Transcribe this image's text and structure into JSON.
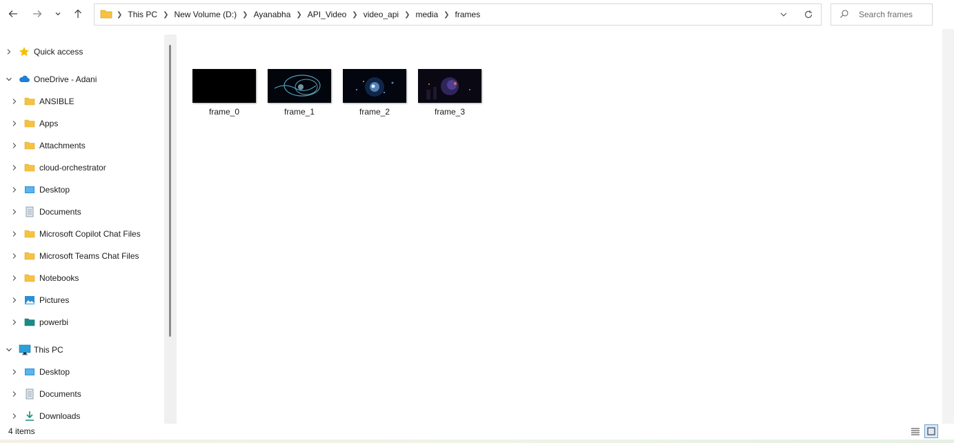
{
  "nav": {
    "back_icon": "arrow-left-icon",
    "forward_icon": "arrow-right-icon",
    "recent_icon": "chevron-down-icon",
    "up_icon": "arrow-up-icon"
  },
  "address": {
    "crumbs": [
      "This PC",
      "New Volume (D:)",
      "Ayanabha",
      "API_Video",
      "video_api",
      "media",
      "frames"
    ]
  },
  "search": {
    "placeholder": "Search frames"
  },
  "sidebar": {
    "items": [
      {
        "label": "Quick access",
        "icon": "star-icon",
        "expanded": false,
        "level": 0
      },
      {
        "label": "OneDrive - Adani",
        "icon": "cloud-icon",
        "expanded": true,
        "level": 0
      },
      {
        "label": "ANSIBLE",
        "icon": "folder-icon",
        "expanded": false,
        "level": 1
      },
      {
        "label": "Apps",
        "icon": "folder-icon",
        "expanded": false,
        "level": 1
      },
      {
        "label": "Attachments",
        "icon": "folder-icon",
        "expanded": false,
        "level": 1
      },
      {
        "label": "cloud-orchestrator",
        "icon": "folder-icon",
        "expanded": false,
        "level": 1
      },
      {
        "label": "Desktop",
        "icon": "desktop-icon",
        "expanded": false,
        "level": 1
      },
      {
        "label": "Documents",
        "icon": "documents-icon",
        "expanded": false,
        "level": 1
      },
      {
        "label": "Microsoft Copilot Chat Files",
        "icon": "folder-icon",
        "expanded": false,
        "level": 1
      },
      {
        "label": "Microsoft Teams Chat Files",
        "icon": "folder-icon",
        "expanded": false,
        "level": 1
      },
      {
        "label": "Notebooks",
        "icon": "folder-icon",
        "expanded": false,
        "level": 1
      },
      {
        "label": "Pictures",
        "icon": "pictures-icon",
        "expanded": false,
        "level": 1
      },
      {
        "label": "powerbi",
        "icon": "teal-folder-icon",
        "expanded": false,
        "level": 1
      },
      {
        "label": "This PC",
        "icon": "monitor-icon",
        "expanded": true,
        "level": 0
      },
      {
        "label": "Desktop",
        "icon": "desktop-icon",
        "expanded": false,
        "level": 1
      },
      {
        "label": "Documents",
        "icon": "documents-icon",
        "expanded": false,
        "level": 1
      },
      {
        "label": "Downloads",
        "icon": "download-icon",
        "expanded": false,
        "level": 1
      }
    ]
  },
  "files": [
    {
      "name": "frame_0",
      "preview": "black"
    },
    {
      "name": "frame_1",
      "preview": "blue-swirl"
    },
    {
      "name": "frame_2",
      "preview": "blue-burst"
    },
    {
      "name": "frame_3",
      "preview": "dark-purple-scene"
    }
  ],
  "status": {
    "count": "4 items"
  },
  "colors": {
    "folder": "#f5c242",
    "accent": "#0067c0",
    "teal": "#1a8a8a"
  }
}
